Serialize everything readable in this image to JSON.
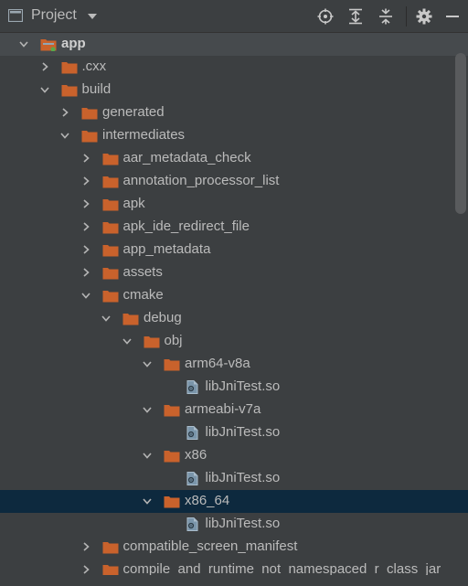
{
  "header": {
    "title": "Project",
    "toolbar": [
      "locate-icon",
      "expand-all-icon",
      "collapse-all-icon",
      "gear-icon",
      "minimize-icon"
    ]
  },
  "colors": {
    "background": "#3c3f41",
    "text": "#bbbbbb",
    "folder": "#c9622c",
    "selected_row": "#0d293e",
    "file_icon": "#6c8fa8"
  },
  "tree": [
    {
      "label": "app",
      "depth": 0,
      "state": "expanded",
      "icon": "module-folder-icon"
    },
    {
      "label": ".cxx",
      "depth": 1,
      "state": "collapsed",
      "icon": "folder-icon"
    },
    {
      "label": "build",
      "depth": 1,
      "state": "expanded",
      "icon": "folder-icon"
    },
    {
      "label": "generated",
      "depth": 2,
      "state": "collapsed",
      "icon": "folder-icon"
    },
    {
      "label": "intermediates",
      "depth": 2,
      "state": "expanded",
      "icon": "folder-icon"
    },
    {
      "label": "aar_metadata_check",
      "depth": 3,
      "state": "collapsed",
      "icon": "folder-icon"
    },
    {
      "label": "annotation_processor_list",
      "depth": 3,
      "state": "collapsed",
      "icon": "folder-icon"
    },
    {
      "label": "apk",
      "depth": 3,
      "state": "collapsed",
      "icon": "folder-icon"
    },
    {
      "label": "apk_ide_redirect_file",
      "depth": 3,
      "state": "collapsed",
      "icon": "folder-icon"
    },
    {
      "label": "app_metadata",
      "depth": 3,
      "state": "collapsed",
      "icon": "folder-icon"
    },
    {
      "label": "assets",
      "depth": 3,
      "state": "collapsed",
      "icon": "folder-icon"
    },
    {
      "label": "cmake",
      "depth": 3,
      "state": "expanded",
      "icon": "folder-icon"
    },
    {
      "label": "debug",
      "depth": 4,
      "state": "expanded",
      "icon": "folder-icon"
    },
    {
      "label": "obj",
      "depth": 5,
      "state": "expanded",
      "icon": "folder-icon"
    },
    {
      "label": "arm64-v8a",
      "depth": 6,
      "state": "expanded",
      "icon": "folder-icon"
    },
    {
      "label": "libJniTest.so",
      "depth": 7,
      "state": "leaf",
      "icon": "so-file-icon"
    },
    {
      "label": "armeabi-v7a",
      "depth": 6,
      "state": "expanded",
      "icon": "folder-icon"
    },
    {
      "label": "libJniTest.so",
      "depth": 7,
      "state": "leaf",
      "icon": "so-file-icon"
    },
    {
      "label": "x86",
      "depth": 6,
      "state": "expanded",
      "icon": "folder-icon"
    },
    {
      "label": "libJniTest.so",
      "depth": 7,
      "state": "leaf",
      "icon": "so-file-icon"
    },
    {
      "label": "x86_64",
      "depth": 6,
      "state": "expanded",
      "icon": "folder-icon",
      "selected": true
    },
    {
      "label": "libJniTest.so",
      "depth": 7,
      "state": "leaf",
      "icon": "so-file-icon"
    },
    {
      "label": "compatible_screen_manifest",
      "depth": 3,
      "state": "collapsed",
      "icon": "folder-icon"
    },
    {
      "label": "compile_and_runtime_not_namespaced_r_class_jar",
      "depth": 3,
      "state": "collapsed",
      "icon": "folder-icon"
    }
  ]
}
